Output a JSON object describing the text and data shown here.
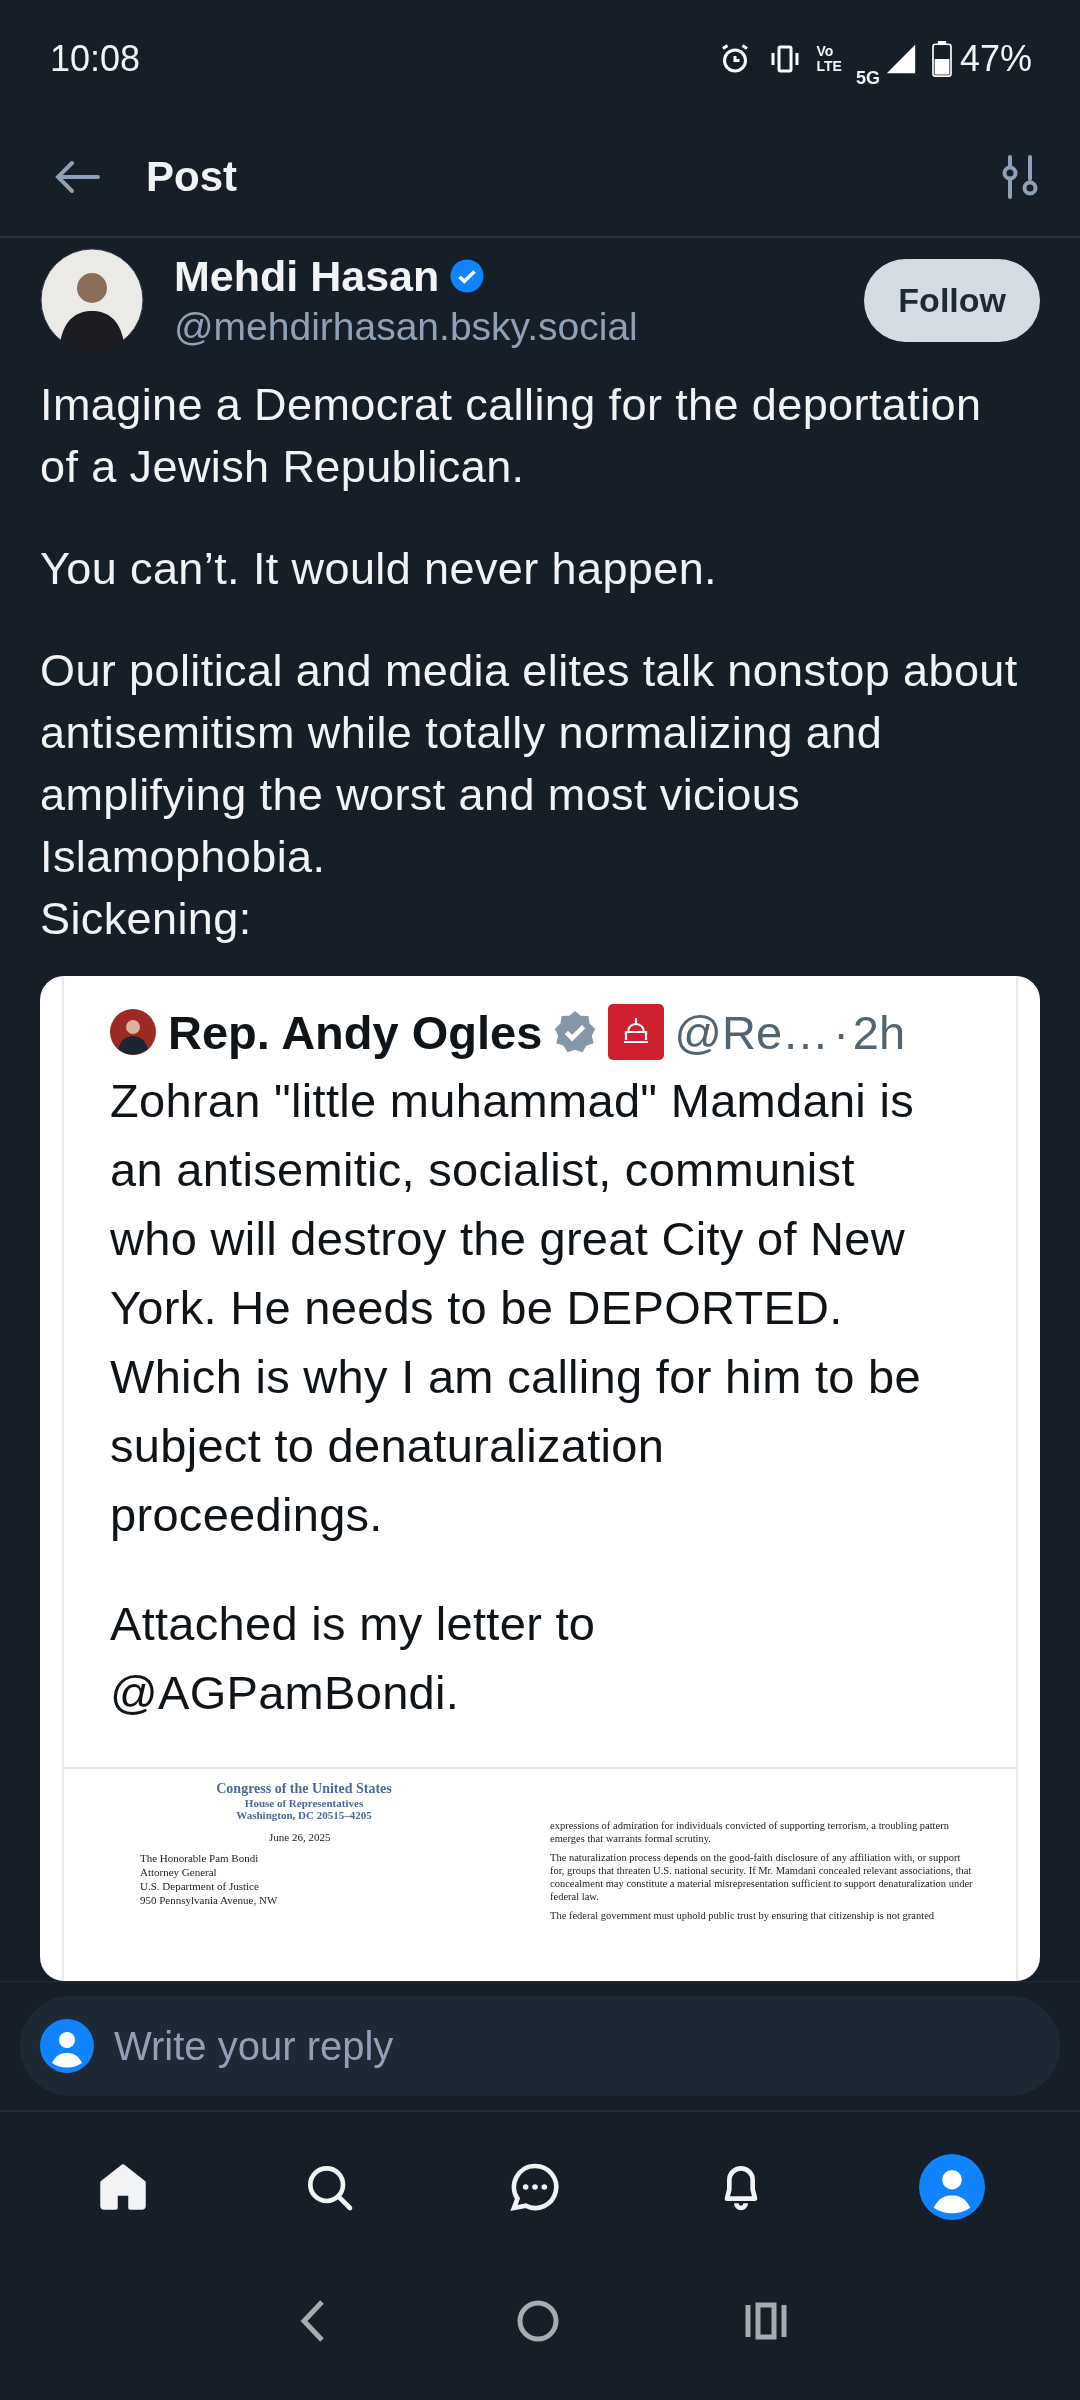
{
  "status_bar": {
    "time": "10:08",
    "volte_top": "Vo",
    "volte_bottom": "LTE",
    "network": "5G",
    "battery": "47%"
  },
  "header": {
    "title": "Post"
  },
  "author": {
    "name": "Mehdi Hasan",
    "verified": true,
    "handle": "@mehdirhasan.bsky.social",
    "follow_label": "Follow"
  },
  "post": {
    "paragraphs": [
      "Imagine a Democrat calling for the deportation of a Jewish Republican.",
      "You can’t. It would never happen.",
      "Our political and media elites talk nonstop about antisemitism while totally normalizing and amplifying the worst and most vicious Islamophobia.\nSickening:"
    ]
  },
  "embed": {
    "name": "Rep. Andy Ogles",
    "verified": true,
    "handle": "@Re…",
    "separator": "·",
    "time": "2h",
    "body": [
      "Zohran \"little muhammad\" Mamdani is an antisemitic, socialist, communist who will destroy the great City of New York. He needs to be DEPORTED. Which is why I am calling for him to be subject to denaturalization proceedings.",
      "Attached is my letter to @AGPamBondi."
    ],
    "letter": {
      "heading": [
        "Congress of the United States",
        "House of Representatives",
        "Washington, DC 20515–4205"
      ],
      "date": "June 26, 2025",
      "address": [
        "The Honorable Pam Bondi",
        "Attorney General",
        "U.S. Department of Justice",
        "950 Pennsylvania Avenue, NW"
      ],
      "right_paragraphs": [
        "expressions of admiration for individuals convicted of supporting terrorism, a troubling pattern emerges that warrants formal scrutiny.",
        "The naturalization process depends on the good-faith disclosure of any affiliation with, or support for, groups that threaten U.S. national security. If Mr. Mamdani concealed relevant associations, that concealment may constitute a material misrepresentation sufficient to support denaturalization under federal law.",
        "The federal government must uphold public trust by ensuring that citizenship is not granted"
      ]
    }
  },
  "reply": {
    "placeholder": "Write your reply"
  },
  "nav": [
    {
      "kind": "home",
      "selected": true
    },
    {
      "kind": "search",
      "selected": false
    },
    {
      "kind": "chat",
      "selected": false
    },
    {
      "kind": "bell",
      "selected": false
    },
    {
      "kind": "profile",
      "selected": false
    }
  ]
}
